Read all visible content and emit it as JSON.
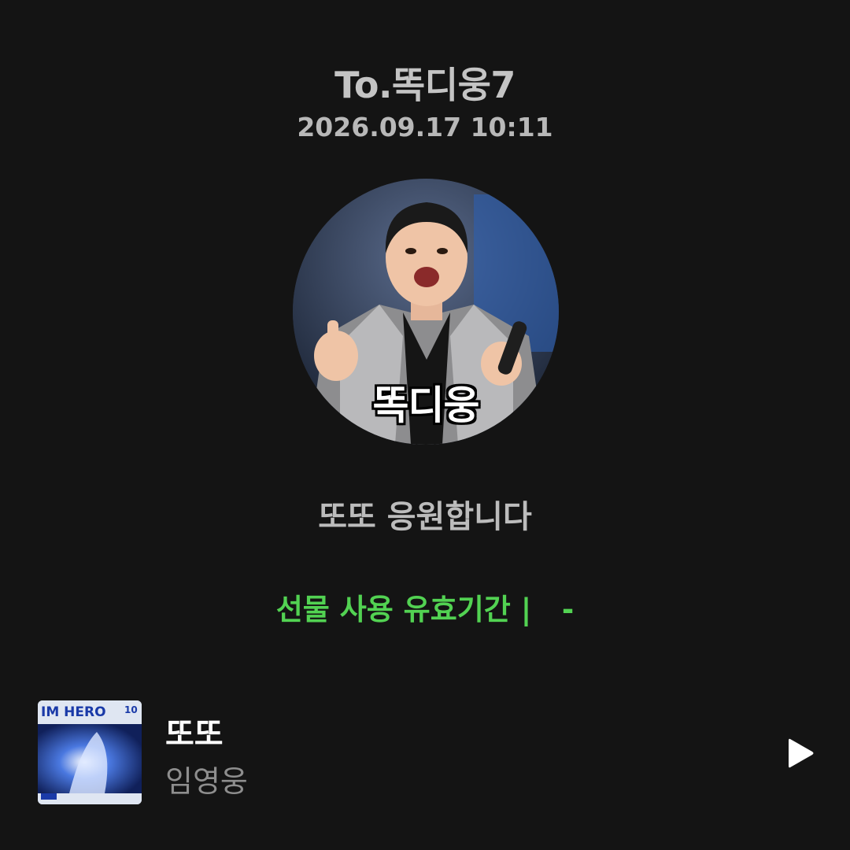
{
  "header": {
    "recipient": "To.똑디웅7",
    "timestamp": "2026.09.17 10:11"
  },
  "avatar": {
    "caption": "똑디웅"
  },
  "message": {
    "text": "또또 응원합니다"
  },
  "gift": {
    "validity_text": "선물 사용 유효기간 |   -",
    "accent_color": "#52d252"
  },
  "track": {
    "title": "또또",
    "artist": "임영웅",
    "album_art_text": "IM HERO",
    "album_art_number": "10",
    "play_icon": "play-icon"
  },
  "colors": {
    "background": "#141414"
  }
}
